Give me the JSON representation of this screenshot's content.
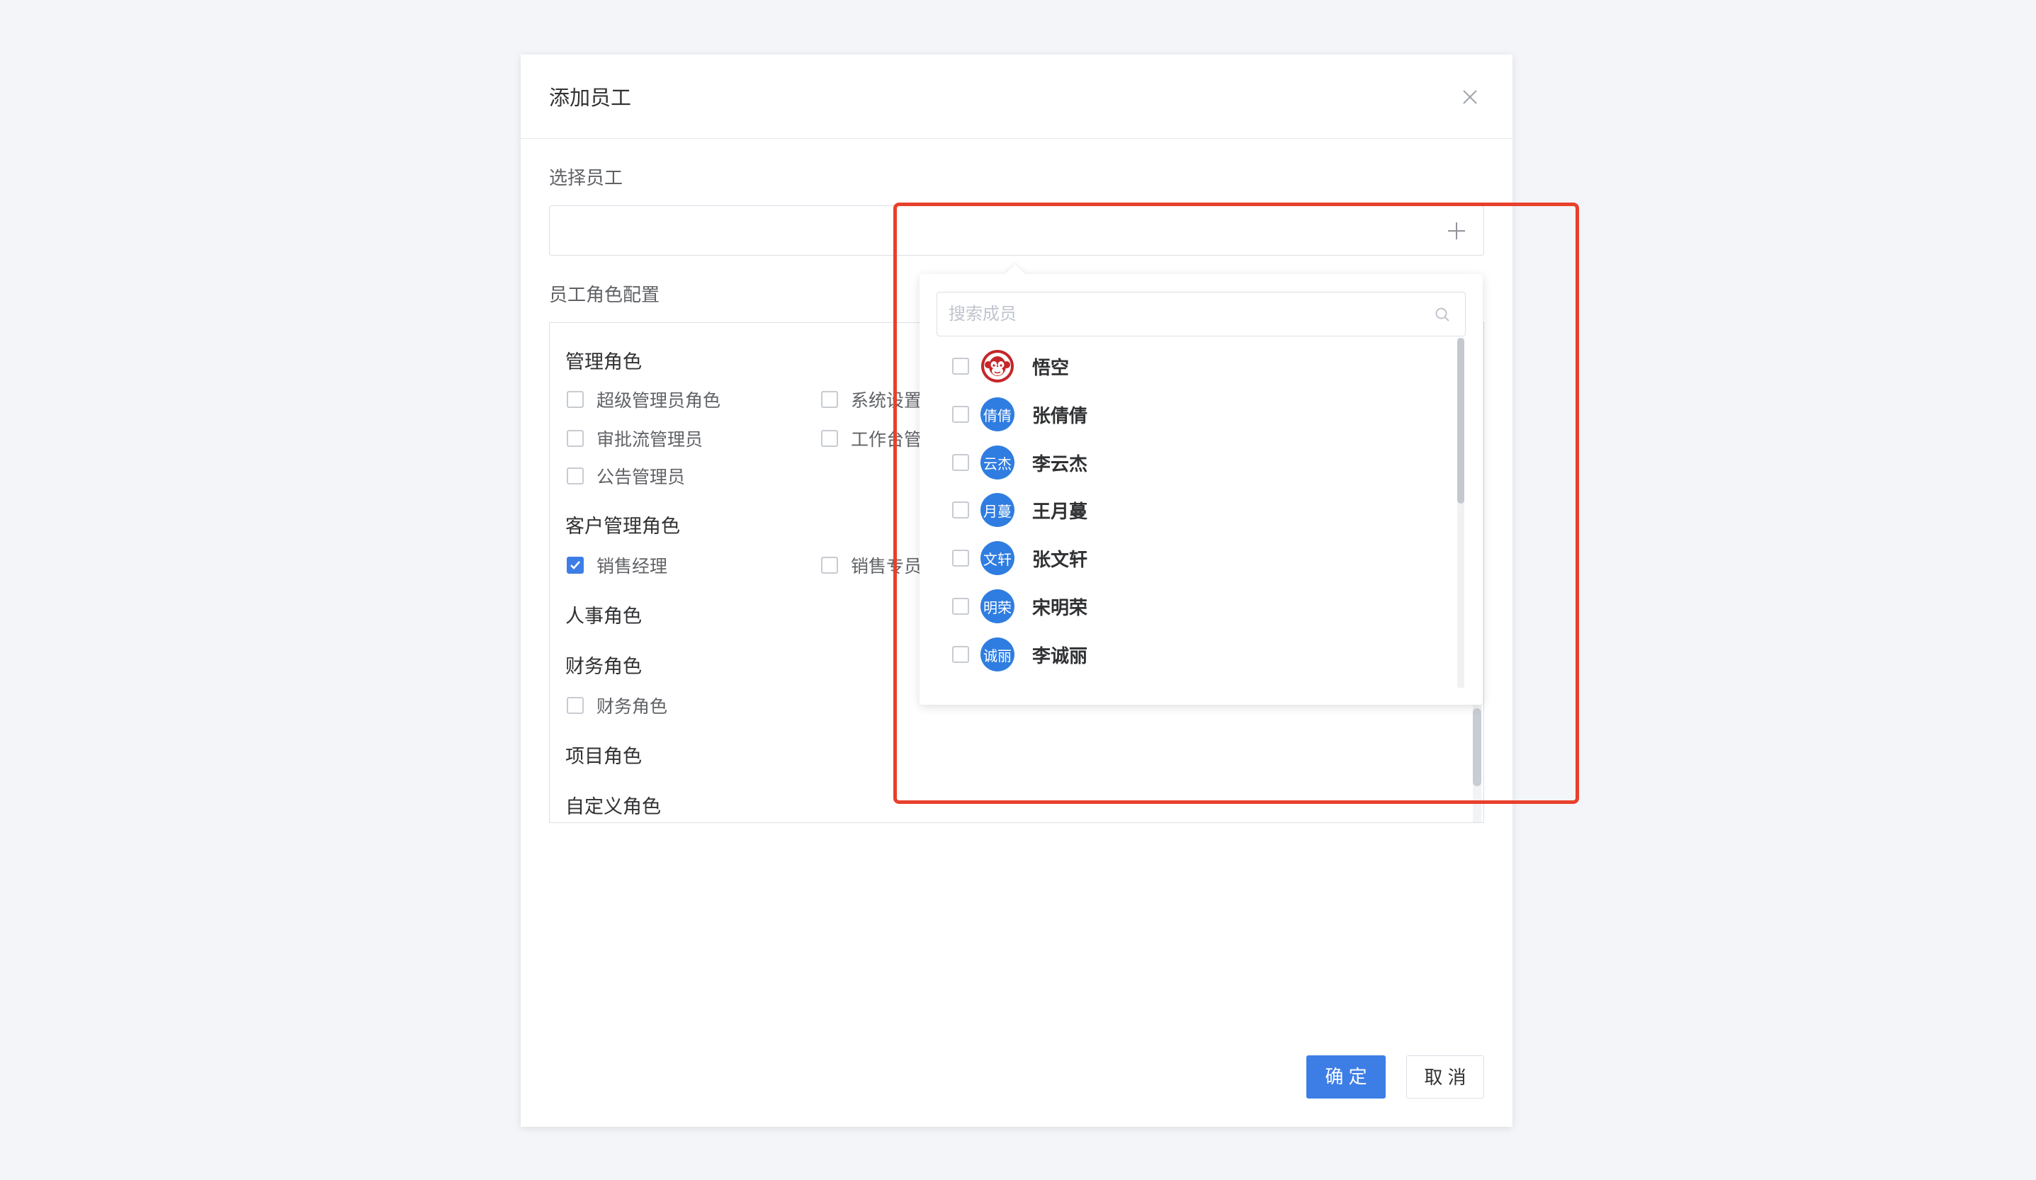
{
  "dialog": {
    "title": "添加员工",
    "close_icon": "close-icon"
  },
  "select_employee": {
    "label": "选择员工",
    "value": "",
    "add_icon": "plus-icon"
  },
  "role_config": {
    "label": "员工角色配置",
    "groups": [
      {
        "title": "管理角色",
        "items": [
          {
            "label": "超级管理员角色",
            "checked": false
          },
          {
            "label": "系统设置",
            "checked": false
          },
          {
            "label": "审批流管理员",
            "checked": false
          },
          {
            "label": "工作台管",
            "checked": false
          },
          {
            "label": "公告管理员",
            "checked": false
          }
        ]
      },
      {
        "title": "客户管理角色",
        "items": [
          {
            "label": "销售经理",
            "checked": true
          },
          {
            "label": "销售专员",
            "checked": false
          }
        ]
      },
      {
        "title": "人事角色",
        "items": []
      },
      {
        "title": "财务角色",
        "items": [
          {
            "label": "财务角色",
            "checked": false
          }
        ]
      },
      {
        "title": "项目角色",
        "items": []
      },
      {
        "title": "自定义角色",
        "items": []
      }
    ]
  },
  "member_picker": {
    "search_placeholder": "搜索成员",
    "search_icon": "search-icon",
    "members": [
      {
        "name": "悟空",
        "avatar": "monkey-logo-icon",
        "avatar_text": "",
        "checked": false
      },
      {
        "name": "张倩倩",
        "avatar_text": "倩倩",
        "checked": false
      },
      {
        "name": "李云杰",
        "avatar_text": "云杰",
        "checked": false
      },
      {
        "name": "王月蔓",
        "avatar_text": "月蔓",
        "checked": false
      },
      {
        "name": "张文轩",
        "avatar_text": "文轩",
        "checked": false
      },
      {
        "name": "宋明荣",
        "avatar_text": "明荣",
        "checked": false
      },
      {
        "name": "李诚丽",
        "avatar_text": "诚丽",
        "checked": false
      }
    ]
  },
  "footer": {
    "confirm_label": "确 定",
    "cancel_label": "取 消"
  },
  "colors": {
    "primary": "#3d7ee6",
    "avatar": "#2f7de1",
    "logo_red": "#c4272a",
    "highlight": "#e8402b",
    "background": "#f4f5f8"
  }
}
